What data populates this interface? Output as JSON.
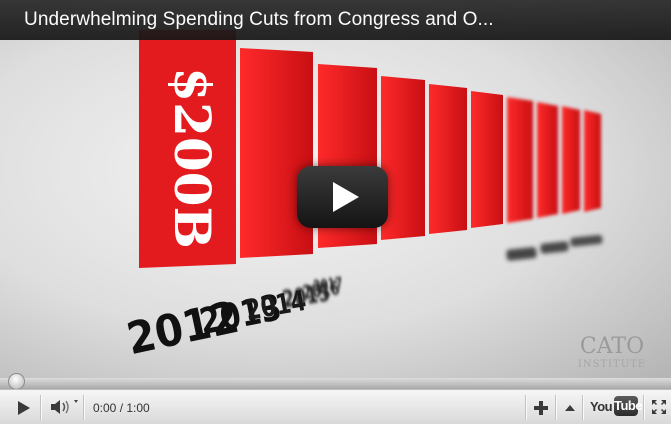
{
  "player": {
    "title": "Underwhelming Spending Cuts from Congress and O...",
    "time_display": "0:00 / 1:00",
    "progress_fraction": 0.0
  },
  "video_frame": {
    "bar_label": "$200B",
    "years": [
      "2012",
      "2013",
      "2014",
      "2015",
      "2016",
      "2017"
    ],
    "logo_line1": "CATO",
    "logo_line2": "INSTITUTE",
    "bar_color": "#e31b1e"
  },
  "controls": {
    "youtube_you": "You",
    "youtube_tube": "Tube"
  },
  "icons": [
    "play-icon",
    "volume-icon",
    "add-icon",
    "expand-arrow-icon",
    "youtube-logo",
    "fullscreen-icon",
    "big-play-icon"
  ]
}
